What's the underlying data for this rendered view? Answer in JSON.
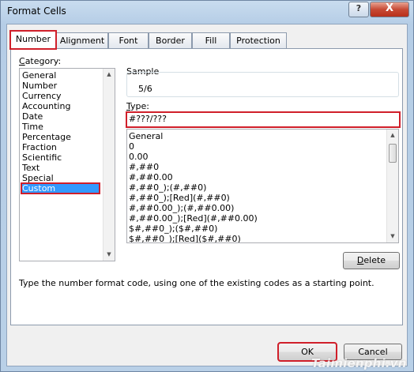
{
  "window": {
    "title": "Format Cells",
    "help_glyph": "?",
    "close_glyph": "X"
  },
  "tabs": [
    {
      "label": "Number",
      "active": true
    },
    {
      "label": "Alignment"
    },
    {
      "label": "Font"
    },
    {
      "label": "Border"
    },
    {
      "label": "Fill"
    },
    {
      "label": "Protection"
    }
  ],
  "category": {
    "label_first": "C",
    "label_rest": "ategory:",
    "items": [
      "General",
      "Number",
      "Currency",
      "Accounting",
      "Date",
      "Time",
      "Percentage",
      "Fraction",
      "Scientific",
      "Text",
      "Special",
      "Custom"
    ],
    "selected": "Custom"
  },
  "sample": {
    "label": "Sample",
    "value": "5/6"
  },
  "type": {
    "label_first": "T",
    "label_rest": "ype:",
    "value": "#???/???"
  },
  "formats": [
    "General",
    "0",
    "0.00",
    "#,##0",
    "#,##0.00",
    "#,##0_);(#,##0)",
    "#,##0_);[Red](#,##0)",
    "#,##0.00_);(#,##0.00)",
    "#,##0.00_);[Red](#,##0.00)",
    "$#,##0_);($#,##0)",
    "$#,##0_);[Red]($#,##0)"
  ],
  "delete_button": {
    "label_first": "D",
    "label_rest": "elete"
  },
  "hint": "Type the number format code, using one of the existing codes as a starting point.",
  "ok_button": "OK",
  "cancel_button": "Cancel",
  "watermark": "Taimienphi.vn",
  "colors": {
    "highlight": "#d01f2a",
    "selection": "#3399ff"
  }
}
